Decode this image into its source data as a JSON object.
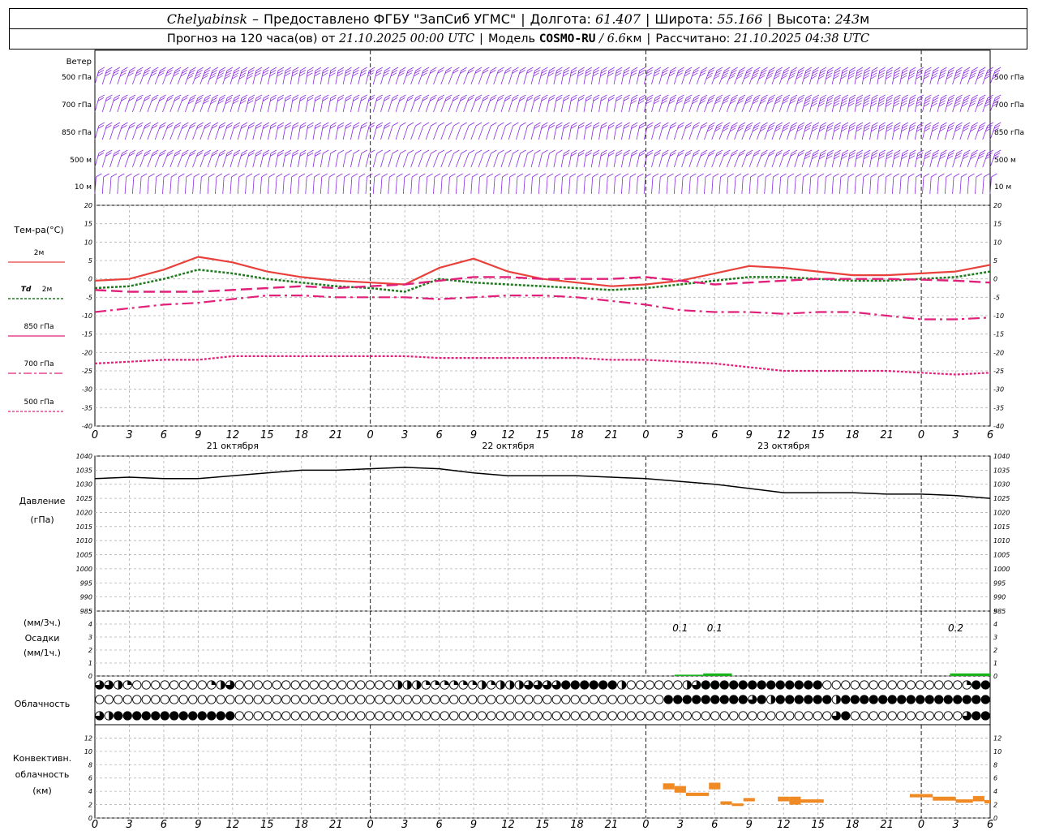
{
  "header": {
    "city": "Chelyabinsk",
    "dash": "–",
    "provider": "Предоставлено ФГБУ \"ЗапСиб УГМС\"",
    "lon_label": "Долгота:",
    "lon_value": "61.407",
    "lat_label": "Широта:",
    "lat_value": "55.166",
    "alt_label": "Высота:",
    "alt_value": "243",
    "alt_unit": "м",
    "forecast_prefix": "Прогноз на 120 часа(ов) от",
    "forecast_start": "21.10.2025 00:00 UTC",
    "model_label": "Модель",
    "model_name": "COSMO-RU",
    "model_slash": "/",
    "model_res": "6.6",
    "model_res_unit": "км",
    "calc_label": "Рассчитано:",
    "calc_time": "21.10.2025 04:38 UTC",
    "sep": "|"
  },
  "colors": {
    "t2m": "#e8413c",
    "td2m": "#1d7a1d",
    "t850": "#e0207a",
    "t700": "#e0207a",
    "t500": "#e0207a",
    "wind": "#8a2be2",
    "pressure": "#000000",
    "precip": "#19b219",
    "conv": "#f08a24",
    "grid": "#b0b0b0",
    "daygrid": "#000000"
  },
  "labels": {
    "wind_title": "Ветер",
    "wind_levels": [
      "500 гПа",
      "700 гПа",
      "850 гПа",
      "500 м",
      "10 м"
    ],
    "temp_title": "Тем-ра(°C)",
    "legend_t2m": "2м",
    "legend_td_sym": "Td",
    "legend_td": "2м",
    "legend_850": "850 гПа",
    "legend_700": "700 гПа",
    "legend_500": "500 гПа",
    "pressure_title": "Давление",
    "pressure_unit": "(гПа)",
    "precip_unit3": "(мм/3ч.)",
    "precip_title": "Осадки",
    "precip_unit1": "(мм/1ч.)",
    "cloud_title": "Облачность",
    "conv_title1": "Конвективн.",
    "conv_title2": "облачность",
    "conv_unit": "(км)"
  },
  "x_ticks": [
    "0",
    "3",
    "6",
    "9",
    "12",
    "15",
    "18",
    "21",
    "0",
    "3",
    "6",
    "9",
    "12",
    "15",
    "18",
    "21",
    "0",
    "3",
    "6",
    "9",
    "12",
    "15",
    "18",
    "21",
    "0",
    "3",
    "6"
  ],
  "dates": [
    "21 октября",
    "22 октября",
    "23 октября"
  ],
  "chart_data": [
    {
      "type": "line",
      "panel": "temperature",
      "x_hours": [
        0,
        3,
        6,
        9,
        12,
        15,
        18,
        21,
        24,
        27,
        30,
        33,
        36,
        39,
        42,
        45,
        48,
        51,
        54,
        57,
        60,
        63,
        66,
        69,
        72,
        75,
        78
      ],
      "y_range": [
        -40,
        20
      ],
      "y_ticks": [
        -40,
        -35,
        -30,
        -25,
        -20,
        -15,
        -10,
        -5,
        0,
        5,
        10,
        15,
        20
      ],
      "series": [
        {
          "name": "2м",
          "values": [
            -0.5,
            0,
            2.5,
            6,
            4.5,
            2,
            0.5,
            -0.5,
            -1,
            -1.5,
            3,
            5.5,
            2,
            0,
            -1,
            -2,
            -1.5,
            -0.5,
            1.5,
            3.5,
            3,
            2,
            1,
            1,
            1.5,
            2,
            3.8
          ]
        },
        {
          "name": "Td 2м",
          "values": [
            -2.5,
            -2,
            0,
            2.5,
            1.5,
            0,
            -1,
            -2,
            -2.5,
            -3.5,
            0,
            -1,
            -1.5,
            -2,
            -2.5,
            -3,
            -2.5,
            -1.5,
            -0.5,
            0.5,
            0.5,
            0,
            -0.5,
            -0.5,
            0,
            0.5,
            2
          ]
        },
        {
          "name": "850 гПа",
          "values": [
            -3,
            -3.5,
            -3.5,
            -3.5,
            -3,
            -2.5,
            -2,
            -2.5,
            -2,
            -1.5,
            -0.5,
            0.5,
            0.5,
            0,
            0,
            0,
            0.5,
            -0.5,
            -1.5,
            -1,
            -0.5,
            0,
            0,
            0,
            -0.2,
            -0.5,
            -1
          ]
        },
        {
          "name": "700 гПа",
          "values": [
            -9,
            -8,
            -7,
            -6.5,
            -5.5,
            -4.5,
            -4.5,
            -5,
            -5,
            -5,
            -5.5,
            -5,
            -4.5,
            -4.5,
            -5,
            -6,
            -7,
            -8.5,
            -9,
            -9,
            -9.5,
            -9,
            -9,
            -10,
            -11,
            -11,
            -10.5
          ]
        },
        {
          "name": "500 гПа",
          "values": [
            -23,
            -22.5,
            -22,
            -22,
            -21,
            -21,
            -21,
            -21,
            -21,
            -21,
            -21.5,
            -21.5,
            -21.5,
            -21.5,
            -21.5,
            -22,
            -22,
            -22.5,
            -23,
            -24,
            -25,
            -25,
            -25,
            -25,
            -25.5,
            -26,
            -25.5
          ]
        }
      ]
    },
    {
      "type": "line",
      "panel": "pressure",
      "x_hours": [
        0,
        3,
        6,
        9,
        12,
        15,
        18,
        21,
        24,
        27,
        30,
        33,
        36,
        39,
        42,
        45,
        48,
        51,
        54,
        57,
        60,
        63,
        66,
        69,
        72,
        75,
        78
      ],
      "y_range": [
        985,
        1040
      ],
      "y_ticks": [
        985,
        990,
        995,
        1000,
        1005,
        1010,
        1015,
        1020,
        1025,
        1030,
        1035,
        1040
      ],
      "series": [
        {
          "name": "Давление",
          "values": [
            1032,
            1032.5,
            1032,
            1032,
            1033,
            1034,
            1035,
            1035,
            1035.5,
            1036,
            1035.5,
            1034,
            1033,
            1033,
            1033,
            1032.5,
            1032,
            1031,
            1030,
            1028.5,
            1027,
            1027,
            1027,
            1026.5,
            1026.5,
            1026,
            1025
          ]
        }
      ]
    },
    {
      "type": "bar",
      "panel": "precipitation",
      "y_range": [
        0,
        5
      ],
      "y_ticks": [
        0,
        1,
        2,
        3,
        4,
        5
      ],
      "annotations": [
        {
          "x": 51,
          "text": "0.1"
        },
        {
          "x": 54,
          "text": "0.1"
        },
        {
          "x": 75,
          "text": "0.2"
        }
      ],
      "bars": [
        {
          "x0": 50.5,
          "x1": 53,
          "value": 0.1
        },
        {
          "x0": 53,
          "x1": 55.5,
          "value": 0.2
        },
        {
          "x0": 74.5,
          "x1": 78,
          "value": 0.2
        }
      ]
    },
    {
      "type": "bar",
      "panel": "convective_cloud",
      "y_range": [
        0,
        14
      ],
      "y_ticks": [
        0,
        2,
        4,
        6,
        8,
        10,
        12
      ],
      "bars": [
        {
          "x0": 49.5,
          "x1": 50.5,
          "low": 4.3,
          "high": 5.2
        },
        {
          "x0": 50.5,
          "x1": 51.5,
          "low": 3.8,
          "high": 4.8
        },
        {
          "x0": 51.5,
          "x1": 53.5,
          "low": 3.3,
          "high": 3.8
        },
        {
          "x0": 53.5,
          "x1": 54.5,
          "low": 4.3,
          "high": 5.3
        },
        {
          "x0": 54.5,
          "x1": 55.5,
          "low": 2.0,
          "high": 2.5
        },
        {
          "x0": 55.5,
          "x1": 56.5,
          "low": 1.8,
          "high": 2.2
        },
        {
          "x0": 56.5,
          "x1": 57.5,
          "low": 2.5,
          "high": 3.0
        },
        {
          "x0": 59.5,
          "x1": 60.5,
          "low": 2.5,
          "high": 3.2
        },
        {
          "x0": 60.5,
          "x1": 61.5,
          "low": 2.0,
          "high": 3.2
        },
        {
          "x0": 61.5,
          "x1": 63.5,
          "low": 2.3,
          "high": 2.8
        },
        {
          "x0": 71,
          "x1": 73,
          "low": 3.1,
          "high": 3.6
        },
        {
          "x0": 73,
          "x1": 75,
          "low": 2.6,
          "high": 3.2
        },
        {
          "x0": 75,
          "x1": 76.5,
          "low": 2.3,
          "high": 2.8
        },
        {
          "x0": 76.5,
          "x1": 77.5,
          "low": 2.5,
          "high": 3.3
        },
        {
          "x0": 77.5,
          "x1": 78,
          "low": 2.2,
          "high": 2.7
        }
      ]
    },
    {
      "type": "table",
      "panel": "cloud_cover",
      "rows": [
        {
          "name": "upper",
          "values": "332100000000123000000000000000002221111112122233334444442000000234444444444444000000000000000144"
        },
        {
          "name": "middle",
          "values": "000000000000000000000000000000000000000000000000000000000000044444444434244444424444444444444444"
        },
        {
          "name": "lower",
          "values": "324444444444444000000000000000000000000000000000000000000000000000000000000000034000000000000344"
        }
      ]
    },
    {
      "type": "table",
      "panel": "wind",
      "levels": [
        "500 гПа",
        "700 гПа",
        "850 гПа",
        "500 м",
        "10 м"
      ],
      "speed_ms": [
        [
          15,
          16,
          17,
          18,
          18,
          17,
          16,
          15,
          14,
          13,
          12,
          12,
          12,
          13,
          14,
          15,
          16,
          17,
          18,
          19,
          20,
          20,
          21,
          21,
          22,
          22,
          23
        ],
        [
          12,
          12,
          12,
          13,
          13,
          12,
          11,
          10,
          10,
          9,
          9,
          9,
          9,
          10,
          11,
          12,
          13,
          14,
          15,
          16,
          17,
          18,
          18,
          19,
          19,
          20,
          20
        ],
        [
          9,
          9,
          9,
          10,
          10,
          10,
          9,
          8,
          8,
          7,
          7,
          7,
          7,
          8,
          9,
          10,
          11,
          12,
          13,
          14,
          14,
          15,
          15,
          16,
          16,
          17,
          17
        ],
        [
          8,
          8,
          8,
          9,
          9,
          9,
          8,
          7,
          7,
          6,
          6,
          6,
          6,
          7,
          8,
          9,
          10,
          11,
          11,
          12,
          12,
          13,
          13,
          14,
          14,
          14,
          15
        ],
        [
          3,
          3,
          3,
          4,
          4,
          4,
          3,
          3,
          3,
          2,
          2,
          2,
          2,
          3,
          3,
          4,
          4,
          5,
          5,
          5,
          5,
          6,
          6,
          6,
          6,
          6,
          6
        ]
      ]
    }
  ]
}
